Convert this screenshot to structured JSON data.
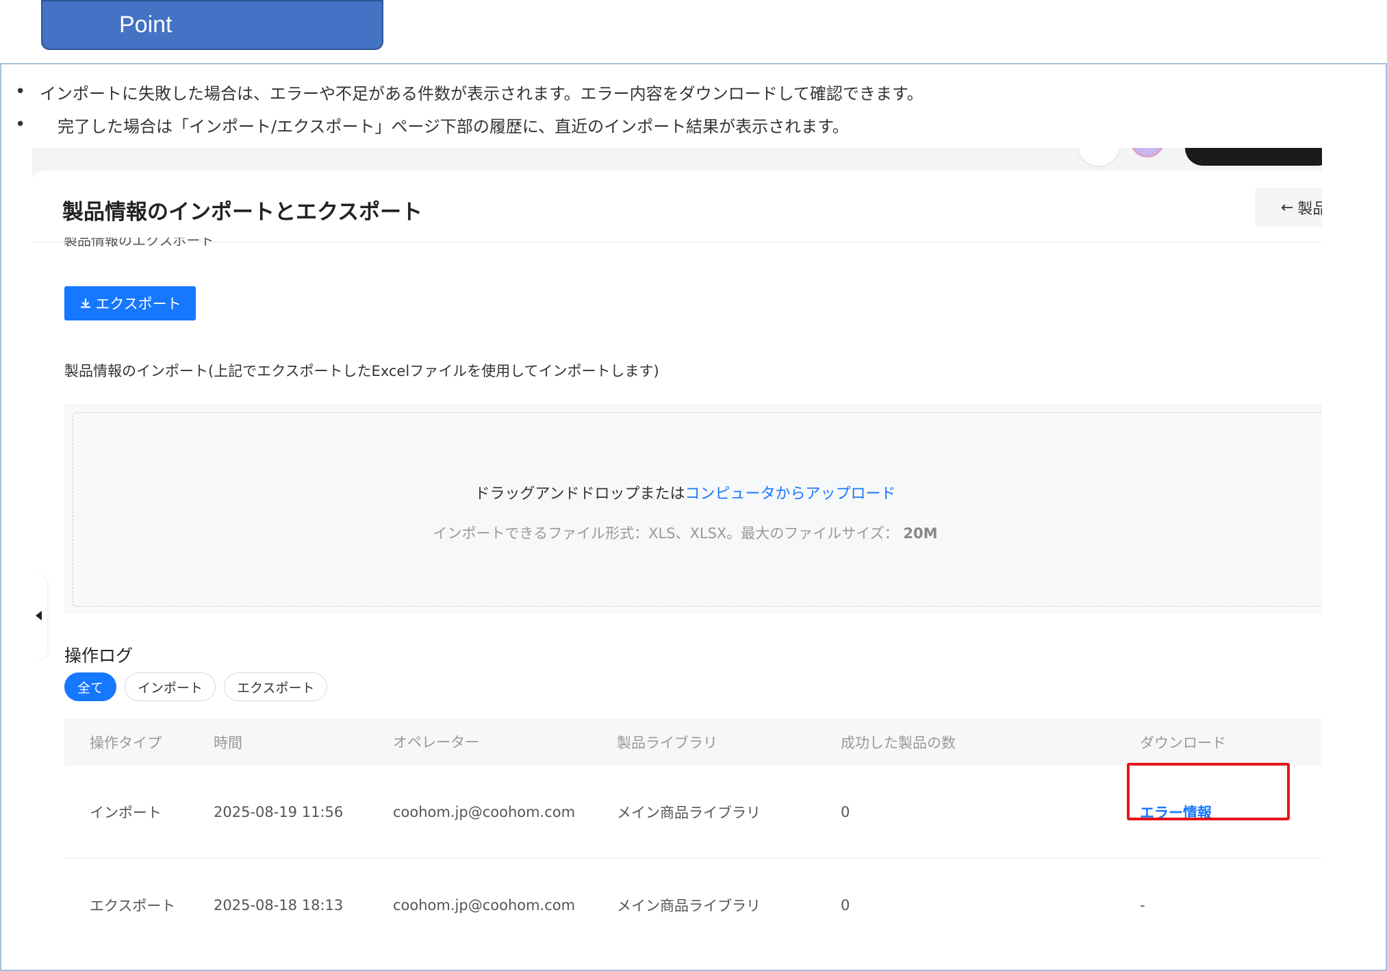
{
  "point_label": "Point",
  "bullets": [
    "インポートに失敗した場合は、エラーや不足がある件数が表示されます。エラー内容をダウンロードして確認できます。",
    "完了した場合は「インポート/エクスポート」ページ下部の履歴に、直近のインポート結果が表示されます。"
  ],
  "bullet_marker": "•",
  "app": {
    "page_title": "製品情報のインポートとエクスポート",
    "back_button": "製品",
    "export_section_label": "製品情報のエクスポート",
    "export_button": "エクスポート",
    "import_label": "製品情報のインポート(上記でエクスポートしたExcelファイルを使用してインポートします)",
    "dropzone": {
      "text": "ドラッグアンドドロップまたは",
      "link": "コンピュータからアップロード",
      "hint": "インポートできるファイル形式：XLS、XLSX。最大のファイルサイズ：",
      "max_size": "20M"
    },
    "log": {
      "title": "操作ログ",
      "filters": [
        "全て",
        "インポート",
        "エクスポート"
      ],
      "active_filter": "全て",
      "columns": [
        "操作タイプ",
        "時間",
        "オペレーター",
        "製品ライブラリ",
        "成功した製品の数",
        "ダウンロード"
      ],
      "rows": [
        {
          "type": "インポート",
          "time": "2025-08-19 11:56",
          "operator": "coohom.jp@coohom.com",
          "library": "メイン商品ライブラリ",
          "count": "0",
          "download": "エラー情報"
        },
        {
          "type": "エクスポート",
          "time": "2025-08-18 18:13",
          "operator": "coohom.jp@coohom.com",
          "library": "メイン商品ライブラリ",
          "count": "0",
          "download": "-"
        }
      ]
    }
  },
  "colors": {
    "accent": "#1677ff",
    "point_tab": "#4472c4",
    "highlight_box": "#e8121a"
  }
}
